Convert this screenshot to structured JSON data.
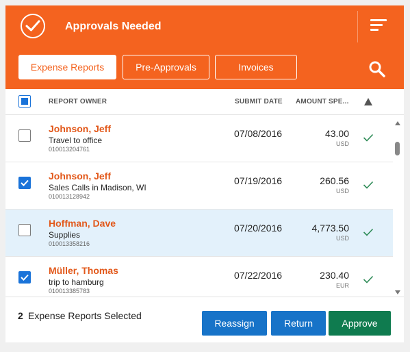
{
  "header": {
    "title": "Approvals Needed",
    "tabs": [
      {
        "label": "Expense Reports",
        "active": true
      },
      {
        "label": "Pre-Approvals",
        "active": false
      },
      {
        "label": "Invoices",
        "active": false
      }
    ]
  },
  "columns": {
    "owner": "REPORT OWNER",
    "date": "SUBMIT DATE",
    "amount": "AMOUNT SPE...",
    "warning": "warning-triangle-icon"
  },
  "rows": [
    {
      "owner": "Johnson, Jeff",
      "purpose": "Travel to office",
      "id": "010013204761",
      "date": "07/08/2016",
      "amount": "43.00",
      "currency": "USD",
      "checked": false,
      "highlighted": false
    },
    {
      "owner": "Johnson, Jeff",
      "purpose": "Sales Calls in Madison, WI",
      "id": "010013128942",
      "date": "07/19/2016",
      "amount": "260.56",
      "currency": "USD",
      "checked": true,
      "highlighted": false
    },
    {
      "owner": "Hoffman, Dave",
      "purpose": "Supplies",
      "id": "010013358216",
      "date": "07/20/2016",
      "amount": "4,773.50",
      "currency": "USD",
      "checked": false,
      "highlighted": true
    },
    {
      "owner": "Müller, Thomas",
      "purpose": "trip to hamburg",
      "id": "010013385783",
      "date": "07/22/2016",
      "amount": "230.40",
      "currency": "EUR",
      "checked": true,
      "highlighted": false
    }
  ],
  "footer": {
    "count": "2",
    "text": "Expense Reports Selected",
    "reassign": "Reassign",
    "return": "Return",
    "approve": "Approve"
  },
  "colors": {
    "brand": "#f4631f",
    "primary_button": "#1773c8",
    "approve_button": "#0f7b4f",
    "checkbox_checked": "#1a73d9",
    "row_highlight": "#e3f1fb",
    "check_green": "#2e8b57"
  }
}
